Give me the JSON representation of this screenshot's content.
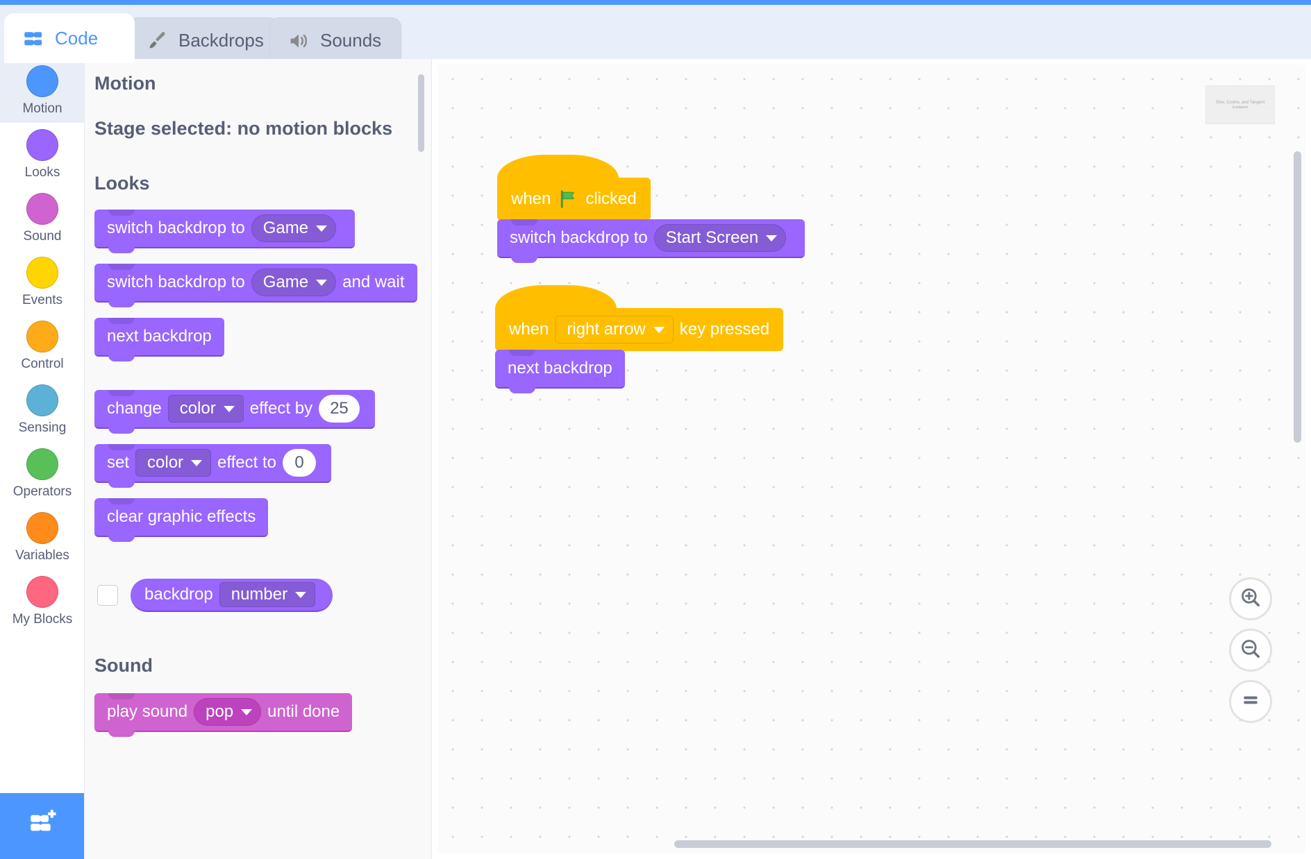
{
  "tabs": [
    {
      "label": "Code",
      "icon": "code-icon",
      "active": true
    },
    {
      "label": "Backdrops",
      "icon": "paintbrush-icon",
      "active": false
    },
    {
      "label": "Sounds",
      "icon": "speaker-icon",
      "active": false
    }
  ],
  "categories": [
    {
      "label": "Motion",
      "color": "#4c97ff",
      "selected": true
    },
    {
      "label": "Looks",
      "color": "#9966ff",
      "selected": false
    },
    {
      "label": "Sound",
      "color": "#cf63cf",
      "selected": false
    },
    {
      "label": "Events",
      "color": "#ffd500",
      "selected": false
    },
    {
      "label": "Control",
      "color": "#ffab19",
      "selected": false
    },
    {
      "label": "Sensing",
      "color": "#5cb1d6",
      "selected": false
    },
    {
      "label": "Operators",
      "color": "#59c059",
      "selected": false
    },
    {
      "label": "Variables",
      "color": "#ff8c1a",
      "selected": false
    },
    {
      "label": "My Blocks",
      "color": "#ff6680",
      "selected": false
    }
  ],
  "add_extension": {
    "name": "add-extension-button",
    "icon": "add-extension-icon"
  },
  "palette": {
    "header": "Motion",
    "note": "Stage selected: no motion blocks",
    "looks_header": "Looks",
    "sound_header": "Sound",
    "blocks": {
      "switch_backdrop": {
        "text": "switch backdrop to",
        "value": "Game"
      },
      "switch_backdrop_wait": {
        "text": "switch backdrop to",
        "value": "Game",
        "suffix": "and wait"
      },
      "next_backdrop": {
        "text": "next backdrop"
      },
      "change_effect": {
        "prefix": "change",
        "value": "color",
        "mid": "effect by",
        "number": "25"
      },
      "set_effect": {
        "prefix": "set",
        "value": "color",
        "mid": "effect to",
        "number": "0"
      },
      "clear_effects": {
        "text": "clear graphic effects"
      },
      "backdrop_reporter": {
        "text": "backdrop",
        "value": "number",
        "checked": false
      },
      "play_sound_until_done": {
        "prefix": "play sound",
        "value": "pop",
        "suffix": "until done"
      }
    }
  },
  "canvas": {
    "watermark": {
      "line1": "Sine, Cosine, and Tangent",
      "line2": "Explained"
    },
    "scripts": [
      {
        "name": "green-flag-script",
        "hat": {
          "prefix": "when",
          "icon": "green-flag-icon",
          "suffix": "clicked"
        },
        "blocks": [
          {
            "type": "looks",
            "text": "switch backdrop to",
            "value": "Start Screen"
          }
        ]
      },
      {
        "name": "right-arrow-script",
        "hat": {
          "prefix": "when",
          "value": "right arrow",
          "suffix": "key pressed"
        },
        "blocks": [
          {
            "type": "looks",
            "text": "next backdrop"
          }
        ]
      }
    ],
    "zoom_controls": [
      {
        "name": "zoom-in-button",
        "icon": "zoom-in-icon"
      },
      {
        "name": "zoom-out-button",
        "icon": "zoom-out-icon"
      },
      {
        "name": "zoom-reset-button",
        "icon": "equals-icon"
      }
    ]
  },
  "colors": {
    "accent": "#4c97ff",
    "looks": "#9966ff",
    "sound": "#cf63cf",
    "events": "#ffbf00",
    "text": "#575e75"
  }
}
